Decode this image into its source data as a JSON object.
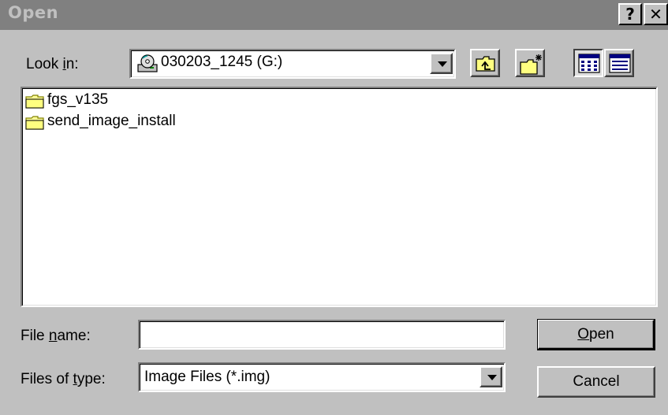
{
  "window": {
    "title": "Open",
    "help_label": "?",
    "close_label": "✕"
  },
  "look_in": {
    "label_pre": "Look ",
    "label_key": "i",
    "label_post": "n:",
    "value": "030203_1245 (G:)",
    "drive_icon": "cd-drive-icon"
  },
  "toolbar": {
    "up_one_level": {
      "icon": "up-folder-icon"
    },
    "new_folder": {
      "icon": "new-folder-icon"
    },
    "list_view": {
      "icon": "list-view-icon"
    },
    "details_view": {
      "icon": "details-view-icon"
    }
  },
  "files": [
    {
      "name": "fgs_v135",
      "icon": "folder-icon"
    },
    {
      "name": "send_image_install",
      "icon": "folder-icon"
    }
  ],
  "file_name": {
    "label_pre": "File ",
    "label_key": "n",
    "label_post": "ame:",
    "value": ""
  },
  "file_type": {
    "label_pre": "Files of ",
    "label_key": "t",
    "label_post": "ype:",
    "value": "Image Files (*.img)"
  },
  "buttons": {
    "open": {
      "label_key": "O",
      "label_rest": "pen"
    },
    "cancel": {
      "label": "Cancel"
    }
  },
  "colors": {
    "face": "#c0c0c0",
    "titlebar_inactive": "#808080",
    "folder": "#ffff99"
  }
}
